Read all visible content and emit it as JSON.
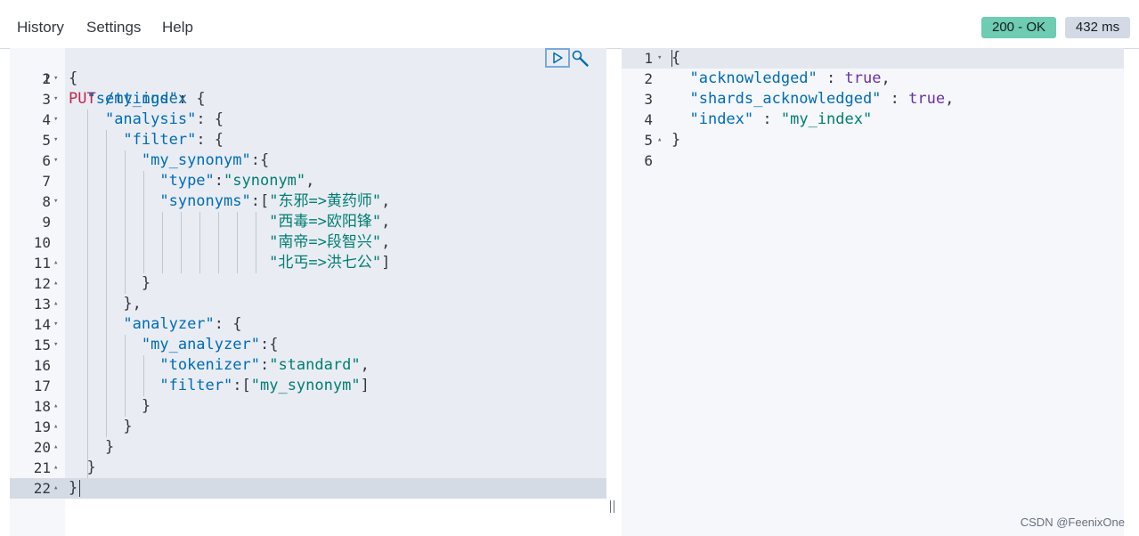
{
  "menu": {
    "history": "History",
    "settings": "Settings",
    "help": "Help"
  },
  "response_meta": {
    "status": "200 - OK",
    "time": "432 ms"
  },
  "request": {
    "line_numbers": [
      "1",
      "2",
      "3",
      "4",
      "5",
      "6",
      "7",
      "8",
      "9",
      "10",
      "11",
      "12",
      "13",
      "14",
      "15",
      "16",
      "17",
      "18",
      "19",
      "20",
      "21",
      "22"
    ],
    "method": "PUT",
    "path": "/my_index",
    "lines": [
      "{",
      "  \"settings\": {",
      "    \"analysis\": {",
      "      \"filter\": {",
      "        \"my_synonym\":{",
      "          \"type\":\"synonym\",",
      "          \"synonyms\":[\"东邪=>黄药师\",",
      "                      \"西毒=>欧阳锋\",",
      "                      \"南帝=>段智兴\",",
      "                      \"北丐=>洪七公\"]",
      "        }",
      "      },",
      "      \"analyzer\": {",
      "        \"my_analyzer\":{",
      "          \"tokenizer\":\"standard\",",
      "          \"filter\":[\"my_synonym\"]",
      "        }",
      "      }",
      "    }",
      "  }",
      "}"
    ]
  },
  "response": {
    "line_numbers": [
      "1",
      "2",
      "3",
      "4",
      "5",
      "6"
    ],
    "lines": [
      "{",
      "  \"acknowledged\" : true,",
      "  \"shards_acknowledged\" : true,",
      "  \"index\" : \"my_index\"",
      "}",
      ""
    ]
  },
  "icons": {
    "run": "play-icon",
    "settings": "wrench-icon"
  },
  "colors": {
    "status_ok": "#6dccb1",
    "time_badge": "#d3dae6",
    "method": "#c7254e",
    "key": "#006bb8",
    "string": "#017d73",
    "bool": "#6a30a8"
  },
  "watermark": "CSDN @FeenixOne"
}
